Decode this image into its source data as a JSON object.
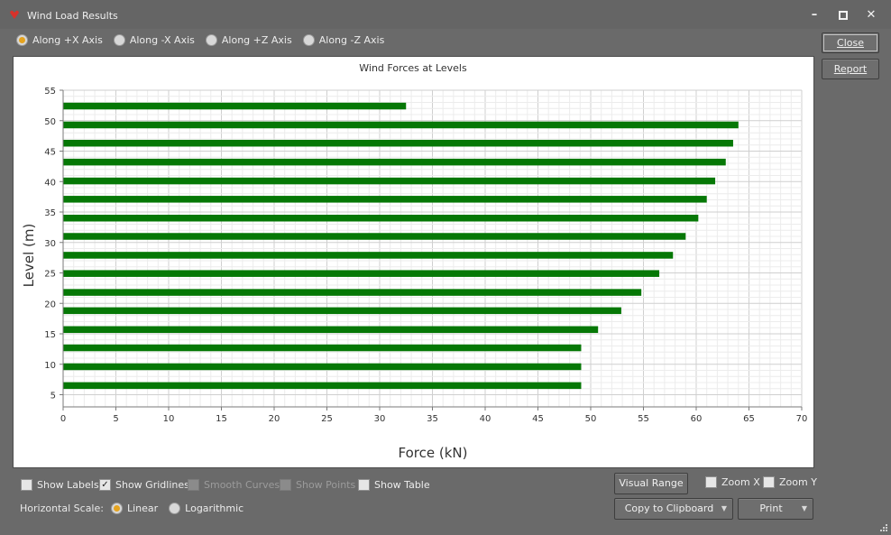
{
  "window": {
    "title": "Wind Load Results"
  },
  "axis_options": [
    {
      "label": "Along +X Axis",
      "selected": true
    },
    {
      "label": "Along -X Axis",
      "selected": false
    },
    {
      "label": "Along +Z Axis",
      "selected": false
    },
    {
      "label": "Along -Z Axis",
      "selected": false
    }
  ],
  "buttons": {
    "close": "Close",
    "report": "Report",
    "visual_range": "Visual Range",
    "copy": "Copy to Clipboard",
    "print": "Print"
  },
  "options": {
    "show_labels": {
      "label": "Show Labels",
      "checked": false,
      "enabled": true
    },
    "show_gridlines": {
      "label": "Show Gridlines",
      "checked": true,
      "enabled": true
    },
    "smooth_curves": {
      "label": "Smooth Curves",
      "checked": false,
      "enabled": false
    },
    "show_points": {
      "label": "Show Points",
      "checked": false,
      "enabled": false
    },
    "show_table": {
      "label": "Show Table",
      "checked": false,
      "enabled": true
    },
    "zoom_x": {
      "label": "Zoom X",
      "checked": false,
      "enabled": true
    },
    "zoom_y": {
      "label": "Zoom Y",
      "checked": false,
      "enabled": true
    }
  },
  "horizontal_scale": {
    "label": "Horizontal Scale:",
    "options": [
      {
        "label": "Linear",
        "selected": true
      },
      {
        "label": "Logarithmic",
        "selected": false
      }
    ]
  },
  "chart_data": {
    "type": "bar",
    "orientation": "horizontal",
    "title": "Wind Forces at Levels",
    "xlabel": "Force (kN)",
    "ylabel": "Level (m)",
    "xlim": [
      0,
      70
    ],
    "ylim": [
      3,
      55
    ],
    "xticks": [
      0,
      5,
      10,
      15,
      20,
      25,
      30,
      35,
      40,
      45,
      50,
      55,
      60,
      65,
      70
    ],
    "yticks": [
      5,
      10,
      15,
      20,
      25,
      30,
      35,
      40,
      45,
      50,
      55
    ],
    "grid": true,
    "bar_color": "#067806",
    "series": [
      {
        "values": [
          {
            "level": 52.4,
            "force": 32.5
          },
          {
            "level": 49.3,
            "force": 64.0
          },
          {
            "level": 46.3,
            "force": 63.5
          },
          {
            "level": 43.2,
            "force": 62.8
          },
          {
            "level": 40.1,
            "force": 61.8
          },
          {
            "level": 37.1,
            "force": 61.0
          },
          {
            "level": 34.0,
            "force": 60.2
          },
          {
            "level": 31.0,
            "force": 59.0
          },
          {
            "level": 27.9,
            "force": 57.8
          },
          {
            "level": 24.9,
            "force": 56.5
          },
          {
            "level": 21.8,
            "force": 54.8
          },
          {
            "level": 18.8,
            "force": 52.9
          },
          {
            "level": 15.7,
            "force": 50.7
          },
          {
            "level": 12.7,
            "force": 49.1
          },
          {
            "level": 9.6,
            "force": 49.1
          },
          {
            "level": 6.5,
            "force": 49.1
          }
        ]
      }
    ]
  }
}
